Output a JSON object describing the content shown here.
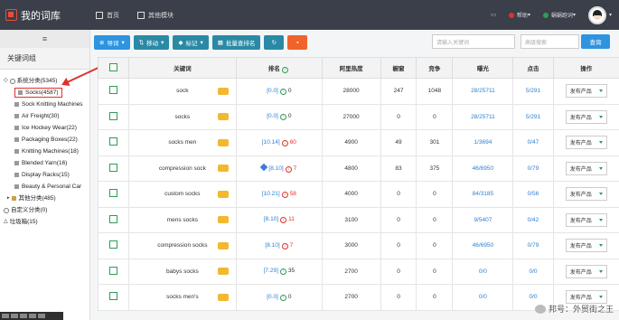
{
  "app": {
    "title": "我的词库"
  },
  "nav": [
    {
      "label": "首页",
      "icon": "home-icon"
    },
    {
      "label": "其他模块",
      "icon": "grid-icon"
    }
  ],
  "top_right": {
    "help": "帮助",
    "user": "蜗蜗跑词",
    "colors": {
      "help": "#e0302a",
      "user": "#2e9d55"
    }
  },
  "sidebar": {
    "title": "关键词组",
    "tree": [
      {
        "label": "系统分类(5345)",
        "level": 0,
        "icon": "circle-icon"
      },
      {
        "label": "Socks(4587)",
        "level": 1,
        "icon": "square-icon",
        "highlight": true
      },
      {
        "label": "Sock Knitting Machines",
        "level": 1,
        "icon": "square-icon"
      },
      {
        "label": "Air Freight(30)",
        "level": 1,
        "icon": "square-icon"
      },
      {
        "label": "Ice Hockey Wear(22)",
        "level": 1,
        "icon": "square-icon"
      },
      {
        "label": "Packaging Boxes(22)",
        "level": 1,
        "icon": "square-icon"
      },
      {
        "label": "Knitting Machines(18)",
        "level": 1,
        "icon": "square-icon"
      },
      {
        "label": "Blended Yarn(16)",
        "level": 1,
        "icon": "square-icon"
      },
      {
        "label": "Display Racks(15)",
        "level": 1,
        "icon": "square-icon"
      },
      {
        "label": "Beauty & Personal Car",
        "level": 1,
        "icon": "square-icon"
      },
      {
        "label": "其他分类(485)",
        "level": 0,
        "icon": "folder-icon"
      },
      {
        "label": "自定义分类(0)",
        "level": 0,
        "icon": "circle-icon"
      },
      {
        "label": "垃圾箱(15)",
        "level": 0,
        "icon": "trash-icon"
      }
    ]
  },
  "toolbar": {
    "buttons": [
      "导词",
      "移动",
      "标记",
      "批量查排名",
      "",
      ""
    ],
    "search_placeholder": "请输入关键词",
    "filter_placeholder": "高级搜索",
    "search_label": "查询"
  },
  "table": {
    "headers": [
      "关键词",
      "排名",
      "阿里热度",
      "橱窗",
      "竞争",
      "曝光",
      "点击",
      "操作"
    ],
    "rows": [
      {
        "keyword": "sock",
        "rank": "[0.0]",
        "rank_change": "0",
        "dir": "up",
        "gem": false,
        "heat": "28000",
        "showcase": "247",
        "compete": "1048",
        "exposure": "28/25711",
        "click": "5/291",
        "action": "发布产品"
      },
      {
        "keyword": "socks",
        "rank": "[0.0]",
        "rank_change": "0",
        "dir": "up",
        "gem": false,
        "heat": "27000",
        "showcase": "0",
        "compete": "0",
        "exposure": "28/25711",
        "click": "5/291",
        "action": "发布产品"
      },
      {
        "keyword": "socks men",
        "rank": "[10.14]",
        "rank_change": "60",
        "dir": "down",
        "gem": false,
        "heat": "4900",
        "showcase": "49",
        "compete": "301",
        "exposure": "1/3694",
        "click": "0/47",
        "action": "发布产品"
      },
      {
        "keyword": "compression sock",
        "rank": "[8.10]",
        "rank_change": "7",
        "dir": "down",
        "gem": true,
        "heat": "4800",
        "showcase": "83",
        "compete": "375",
        "exposure": "46/6950",
        "click": "0/79",
        "action": "发布产品"
      },
      {
        "keyword": "custom socks",
        "rank": "[10.21]",
        "rank_change": "58",
        "dir": "down",
        "gem": false,
        "heat": "4000",
        "showcase": "0",
        "compete": "0",
        "exposure": "84/3185",
        "click": "0/56",
        "action": "发布产品"
      },
      {
        "keyword": "mens socks",
        "rank": "[8.10]",
        "rank_change": "11",
        "dir": "down",
        "gem": false,
        "heat": "3100",
        "showcase": "0",
        "compete": "0",
        "exposure": "9/5407",
        "click": "0/42",
        "action": "发布产品"
      },
      {
        "keyword": "compression socks",
        "rank": "[8.10]",
        "rank_change": "7",
        "dir": "down",
        "gem": false,
        "heat": "3000",
        "showcase": "0",
        "compete": "0",
        "exposure": "46/6950",
        "click": "0/79",
        "action": "发布产品"
      },
      {
        "keyword": "babys socks",
        "rank": "[7.29]",
        "rank_change": "35",
        "dir": "up",
        "gem": false,
        "heat": "2700",
        "showcase": "0",
        "compete": "0",
        "exposure": "0/0",
        "click": "0/0",
        "action": "发布产品"
      },
      {
        "keyword": "socks men's",
        "rank": "[0.0]",
        "rank_change": "0",
        "dir": "up",
        "gem": false,
        "heat": "2700",
        "showcase": "0",
        "compete": "0",
        "exposure": "0/0",
        "click": "0/0",
        "action": "发布产品"
      }
    ]
  },
  "watermark": "邦号：外贸街之王"
}
